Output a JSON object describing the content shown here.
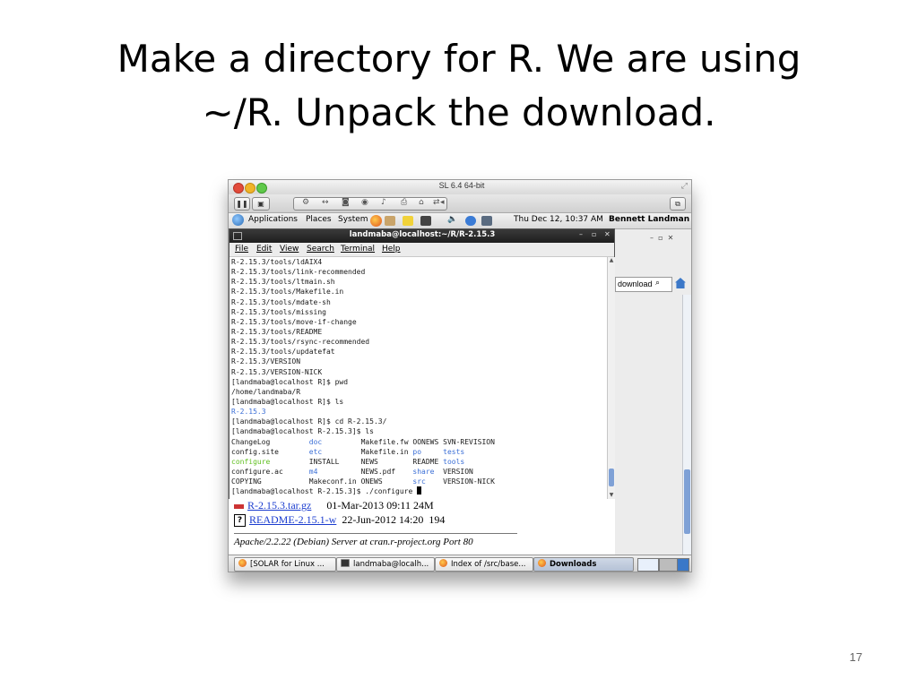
{
  "slide": {
    "title_line1": "Make a directory for R. We are using",
    "title_line2": "~/R. Unpack the download.",
    "page_number": "17"
  },
  "vm_window": {
    "title": "SL 6.4 64-bit",
    "toolbar_icons": [
      "pause-icon",
      "snapshot-icon",
      "settings-icon",
      "back-forward-icon",
      "disk-icon",
      "camera-icon",
      "sound-icon",
      "printer-icon",
      "lock-icon",
      "usb-icon",
      "arrow-icon",
      "fullscreen-icon"
    ]
  },
  "guest_panel": {
    "applications": "Applications",
    "places": "Places",
    "system": "System",
    "datetime": "Thu Dec 12, 10:37 AM",
    "user": "Bennett Landman"
  },
  "terminal": {
    "title": "landmaba@localhost:~/R/R-2.15.3",
    "menu": {
      "file": "File",
      "edit": "Edit",
      "view": "View",
      "search": "Search",
      "terminal": "Terminal",
      "help": "Help"
    },
    "lines": [
      "R-2.15.3/tools/ldAIX4",
      "R-2.15.3/tools/link-recommended",
      "R-2.15.3/tools/ltmain.sh",
      "R-2.15.3/tools/Makefile.in",
      "R-2.15.3/tools/mdate-sh",
      "R-2.15.3/tools/missing",
      "R-2.15.3/tools/move-if-change",
      "R-2.15.3/tools/README",
      "R-2.15.3/tools/rsync-recommended",
      "R-2.15.3/tools/updatefat",
      "R-2.15.3/VERSION",
      "R-2.15.3/VERSION-NICK",
      "[landmaba@localhost R]$ pwd",
      "/home/landmaba/R",
      "[landmaba@localhost R]$ ls"
    ],
    "ls_r_output": "R-2.15.3",
    "cd_cmd": "[landmaba@localhost R]$ cd R-2.15.3/",
    "ls_cmd": "[landmaba@localhost R-2.15.3]$ ls",
    "ls_rows": [
      [
        "ChangeLog",
        "doc",
        "Makefile.fw",
        "OONEWS",
        "SVN-REVISION"
      ],
      [
        "config.site",
        "etc",
        "Makefile.in",
        "po",
        "tests"
      ],
      [
        "configure",
        "INSTALL",
        "NEWS",
        "README",
        "tools"
      ],
      [
        "configure.ac",
        "m4",
        "NEWS.pdf",
        "share",
        "VERSION"
      ],
      [
        "COPYING",
        "Makeconf.in",
        "ONEWS",
        "src",
        "VERSION-NICK"
      ]
    ],
    "final_prompt": "[landmaba@localhost R-2.15.3]$ ./configure "
  },
  "browser": {
    "address_fragment": "download",
    "rows": [
      {
        "link": "R-2.15.3.tar.gz",
        "date": "01-Mar-2013 09:11",
        "size": "24M"
      },
      {
        "link": "README-2.15.1-w",
        "date": "22-Jun-2012 14:20",
        "size": "194"
      }
    ],
    "footer": "Apache/2.2.22 (Debian) Server at cran.r-project.org Port 80"
  },
  "taskbar": {
    "tasks": [
      "[SOLAR for Linux ...",
      "landmaba@localh...",
      "Index of /src/base...",
      "Downloads"
    ]
  },
  "colors": {
    "terminal_dir": "#3b6fd6",
    "terminal_exec": "#5fbf1f",
    "link": "#1a3ccf"
  }
}
